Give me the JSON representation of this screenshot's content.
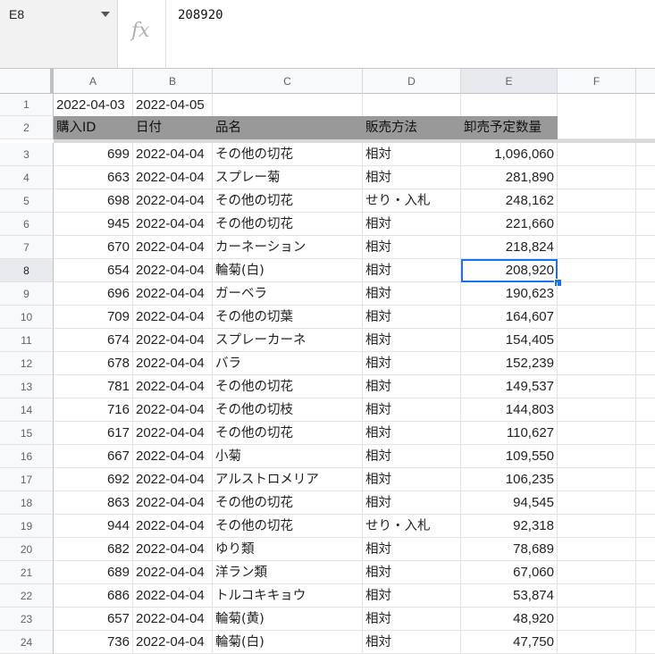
{
  "formula_bar": {
    "cell_ref": "E8",
    "fx_label": "fx",
    "value": "208920"
  },
  "columns": [
    "A",
    "B",
    "C",
    "D",
    "E",
    "F"
  ],
  "selected": {
    "row": 8,
    "col": "E"
  },
  "row1": {
    "A": "2022-04-03",
    "B": "2022-04-05"
  },
  "header": {
    "A": "購入ID",
    "B": "日付",
    "C": "品名",
    "D": "販売方法",
    "E": "卸売予定数量"
  },
  "rows": [
    {
      "n": "3",
      "id": "699",
      "date": "2022-04-04",
      "name": "その他の切花",
      "method": "相対",
      "qty": "1,096,060"
    },
    {
      "n": "4",
      "id": "663",
      "date": "2022-04-04",
      "name": "スプレー菊",
      "method": "相対",
      "qty": "281,890"
    },
    {
      "n": "5",
      "id": "698",
      "date": "2022-04-04",
      "name": "その他の切花",
      "method": "せり・入札",
      "qty": "248,162"
    },
    {
      "n": "6",
      "id": "945",
      "date": "2022-04-04",
      "name": "その他の切花",
      "method": "相対",
      "qty": "221,660"
    },
    {
      "n": "7",
      "id": "670",
      "date": "2022-04-04",
      "name": "カーネーション",
      "method": "相対",
      "qty": "218,824"
    },
    {
      "n": "8",
      "id": "654",
      "date": "2022-04-04",
      "name": "輪菊(白)",
      "method": "相対",
      "qty": "208,920"
    },
    {
      "n": "9",
      "id": "696",
      "date": "2022-04-04",
      "name": "ガーベラ",
      "method": "相対",
      "qty": "190,623"
    },
    {
      "n": "10",
      "id": "709",
      "date": "2022-04-04",
      "name": "その他の切葉",
      "method": "相対",
      "qty": "164,607"
    },
    {
      "n": "11",
      "id": "674",
      "date": "2022-04-04",
      "name": "スプレーカーネ",
      "method": "相対",
      "qty": "154,405"
    },
    {
      "n": "12",
      "id": "678",
      "date": "2022-04-04",
      "name": "バラ",
      "method": "相対",
      "qty": "152,239"
    },
    {
      "n": "13",
      "id": "781",
      "date": "2022-04-04",
      "name": "その他の切花",
      "method": "相対",
      "qty": "149,537"
    },
    {
      "n": "14",
      "id": "716",
      "date": "2022-04-04",
      "name": "その他の切枝",
      "method": "相対",
      "qty": "144,803"
    },
    {
      "n": "15",
      "id": "617",
      "date": "2022-04-04",
      "name": "その他の切花",
      "method": "相対",
      "qty": "110,627"
    },
    {
      "n": "16",
      "id": "667",
      "date": "2022-04-04",
      "name": "小菊",
      "method": "相対",
      "qty": "109,550"
    },
    {
      "n": "17",
      "id": "692",
      "date": "2022-04-04",
      "name": "アルストロメリア",
      "method": "相対",
      "qty": "106,235"
    },
    {
      "n": "18",
      "id": "863",
      "date": "2022-04-04",
      "name": "その他の切花",
      "method": "相対",
      "qty": "94,545"
    },
    {
      "n": "19",
      "id": "944",
      "date": "2022-04-04",
      "name": "その他の切花",
      "method": "せり・入札",
      "qty": "92,318"
    },
    {
      "n": "20",
      "id": "682",
      "date": "2022-04-04",
      "name": "ゆり類",
      "method": "相対",
      "qty": "78,689"
    },
    {
      "n": "21",
      "id": "689",
      "date": "2022-04-04",
      "name": "洋ラン類",
      "method": "相対",
      "qty": "67,060"
    },
    {
      "n": "22",
      "id": "686",
      "date": "2022-04-04",
      "name": "トルコキキョウ",
      "method": "相対",
      "qty": "53,874"
    },
    {
      "n": "23",
      "id": "657",
      "date": "2022-04-04",
      "name": "輪菊(黄)",
      "method": "相対",
      "qty": "48,920"
    },
    {
      "n": "24",
      "id": "736",
      "date": "2022-04-04",
      "name": "輪菊(白)",
      "method": "相対",
      "qty": "47,750"
    }
  ]
}
